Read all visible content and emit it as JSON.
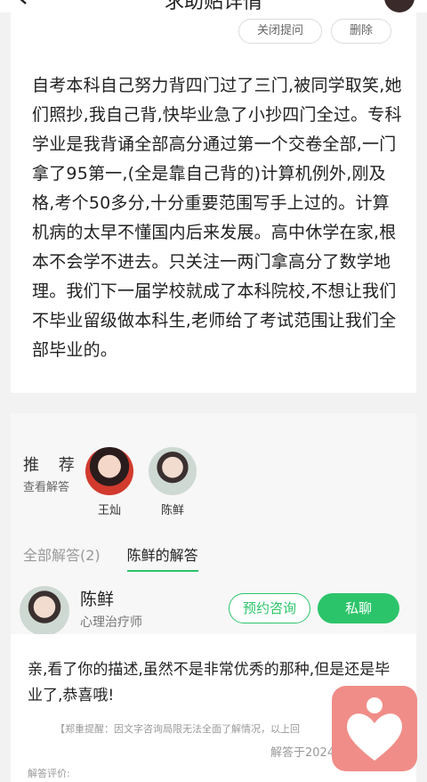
{
  "header": {
    "title": "求助贴详情"
  },
  "question": {
    "close_label": "关闭提问",
    "delete_label": "删除",
    "text": "自考本科自己努力背四门过了三门,被同学取笑,她们照抄,我自己背,快毕业急了小抄四门全过。专科学业是我背诵全部高分通过第一个交卷全部,一门拿了95第一,(全是靠自己背的)计算机例外,刚及格,考个50多分,十分重要范围写手上过的。计算机病的太早不懂国内后来发展。高中休学在家,根本不会学不进去。只关注一两门拿高分了数学地理。我们下一届学校就成了本科院校,不想让我们不毕业留级做本科生,老师给了考试范围让我们全部毕业的。"
  },
  "recommend": {
    "title": "推 荐",
    "subtitle": "查看解答",
    "experts": [
      {
        "name": "王灿"
      },
      {
        "name": "陈鲜"
      }
    ]
  },
  "tabs": [
    {
      "label": "全部解答(2)"
    },
    {
      "label": "陈鲜的解答"
    }
  ],
  "expert": {
    "name": "陈鲜",
    "title": "心理治疗师",
    "consult_label": "预约咨询",
    "chat_label": "私聊"
  },
  "answer": {
    "text": "亲,看了你的描述,虽然不是非常优秀的那种,但是还是毕业了,恭喜哦!",
    "notice": "【郑重提醒：因文字咨询局限无法全面了解情况，以上回",
    "date": "解答于2024",
    "rating_label": "解答评价:"
  },
  "colors": {
    "accent": "#2cc46a",
    "fab": "#f08d88"
  },
  "icons": {
    "back": "chevron-left-icon",
    "fab": "heart-person-icon"
  }
}
